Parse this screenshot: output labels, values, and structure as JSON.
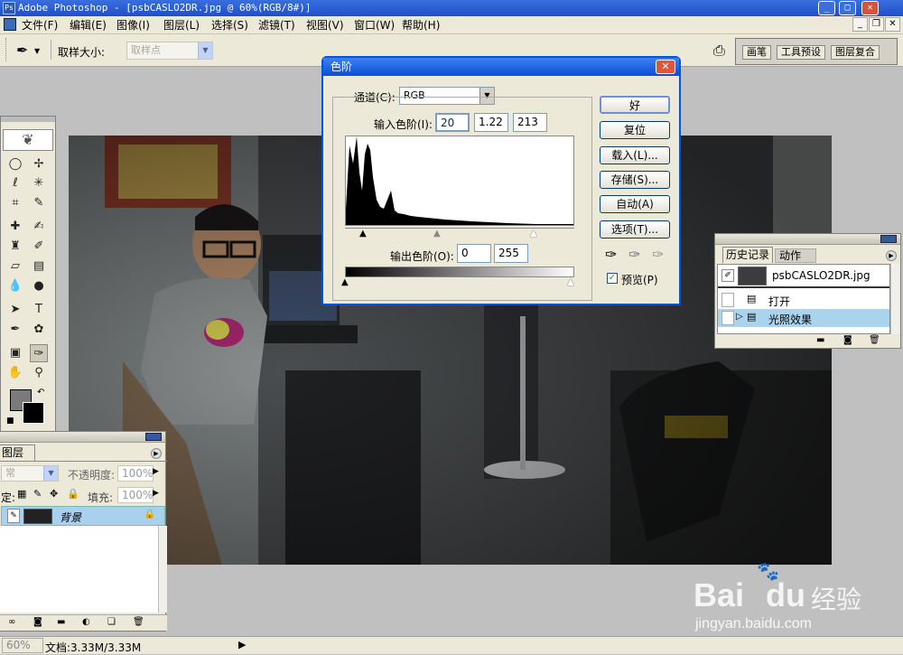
{
  "window": {
    "title": "Adobe Photoshop - [psbCASLO2DR.jpg @ 60%(RGB/8#)]",
    "app_icon": "Ps"
  },
  "menu": [
    "文件(F)",
    "编辑(E)",
    "图像(I)",
    "图层(L)",
    "选择(S)",
    "滤镜(T)",
    "视图(V)",
    "窗口(W)",
    "帮助(H)"
  ],
  "options_bar": {
    "sample_size_label": "取样大小:",
    "sample_size_value": "取样点",
    "wells": [
      "画笔",
      "工具预设",
      "图层复合"
    ]
  },
  "levels_dialog": {
    "title": "色阶",
    "channel_label": "通道(C):",
    "channel_value": "RGB",
    "input_levels_label": "输入色阶(I):",
    "input_levels": [
      "20",
      "1.22",
      "213"
    ],
    "output_levels_label": "输出色阶(O):",
    "output_levels": [
      "0",
      "255"
    ],
    "buttons": {
      "ok": "好",
      "reset": "复位",
      "load": "载入(L)...",
      "save": "存储(S)...",
      "auto": "自动(A)",
      "options": "选项(T)..."
    },
    "preview_label": "预览(P)",
    "preview_checked": true
  },
  "history_panel": {
    "tabs": [
      "历史记录",
      "动作"
    ],
    "snapshot": "psbCASLO2DR.jpg",
    "states": [
      "打开",
      "光照效果"
    ],
    "active_state": 1
  },
  "layers_panel": {
    "tab": "图层",
    "blend_mode": "常",
    "opacity_label": "不透明度:",
    "opacity_value": "100%",
    "lock_label": "定:",
    "fill_label": "填充:",
    "fill_value": "100%",
    "layer_name": "背景"
  },
  "status_bar": {
    "zoom": "60%",
    "doc_info": "文档:3.33M/3.33M"
  },
  "watermark": {
    "brand": "Bai",
    "brand2": "du",
    "cn": "经验",
    "url": "jingyan.baidu.com"
  }
}
